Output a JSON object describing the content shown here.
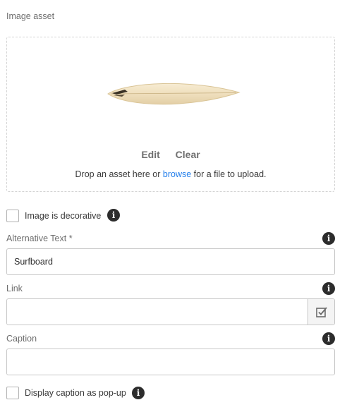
{
  "image_asset": {
    "label": "Image asset",
    "edit_label": "Edit",
    "clear_label": "Clear",
    "drop_hint_before": "Drop an asset here or ",
    "drop_hint_link": "browse",
    "drop_hint_after": " for a file to upload."
  },
  "decorative": {
    "label": "Image is decorative",
    "checked": false
  },
  "alt_text": {
    "label": "Alternative Text *",
    "value": "Surfboard"
  },
  "link": {
    "label": "Link",
    "value": ""
  },
  "caption": {
    "label": "Caption",
    "value": ""
  },
  "caption_popup": {
    "label": "Display caption as pop-up",
    "checked": false
  },
  "colors": {
    "link": "#2680eb",
    "info_icon": "#2c2c2c"
  }
}
